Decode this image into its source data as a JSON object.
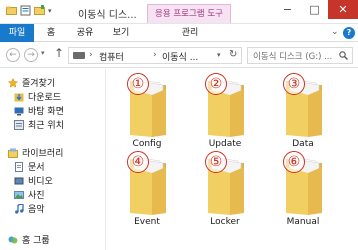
{
  "window": {
    "title": "이동식 디스...",
    "context_tab": "응용 프로그램 도구",
    "controls": {
      "minimize": "−",
      "maximize": "□",
      "close": "✕"
    }
  },
  "ribbon": {
    "file": "파일",
    "home": "홈",
    "share": "공유",
    "view": "보기",
    "manage": "관리",
    "help": "?"
  },
  "address": {
    "crumbs": [
      "컴퓨터",
      "이동식 ..."
    ],
    "separator": "›",
    "search_placeholder": "이동식 디스크 (G:) ..."
  },
  "nav": {
    "favorites": "즐겨찾기",
    "downloads": "다운로드",
    "desktop": "바탕 화면",
    "recent": "최근 위치",
    "libraries": "라이브러리",
    "documents": "문서",
    "videos": "비디오",
    "pictures": "사진",
    "music": "음악",
    "homegroup": "홈 그룹"
  },
  "folders": [
    {
      "number": "①",
      "name": "Config"
    },
    {
      "number": "②",
      "name": "Update"
    },
    {
      "number": "③",
      "name": "Data"
    },
    {
      "number": "④",
      "name": "Event"
    },
    {
      "number": "⑤",
      "name": "Locker"
    },
    {
      "number": "⑥",
      "name": "Manual"
    }
  ],
  "colors": {
    "accent": "#1979ca",
    "close": "#c7352a",
    "context_tab_bg": "#f6e2f2",
    "context_tab_text": "#a2367e",
    "annotation": "#d0301f",
    "folder": "#f2cf63"
  }
}
